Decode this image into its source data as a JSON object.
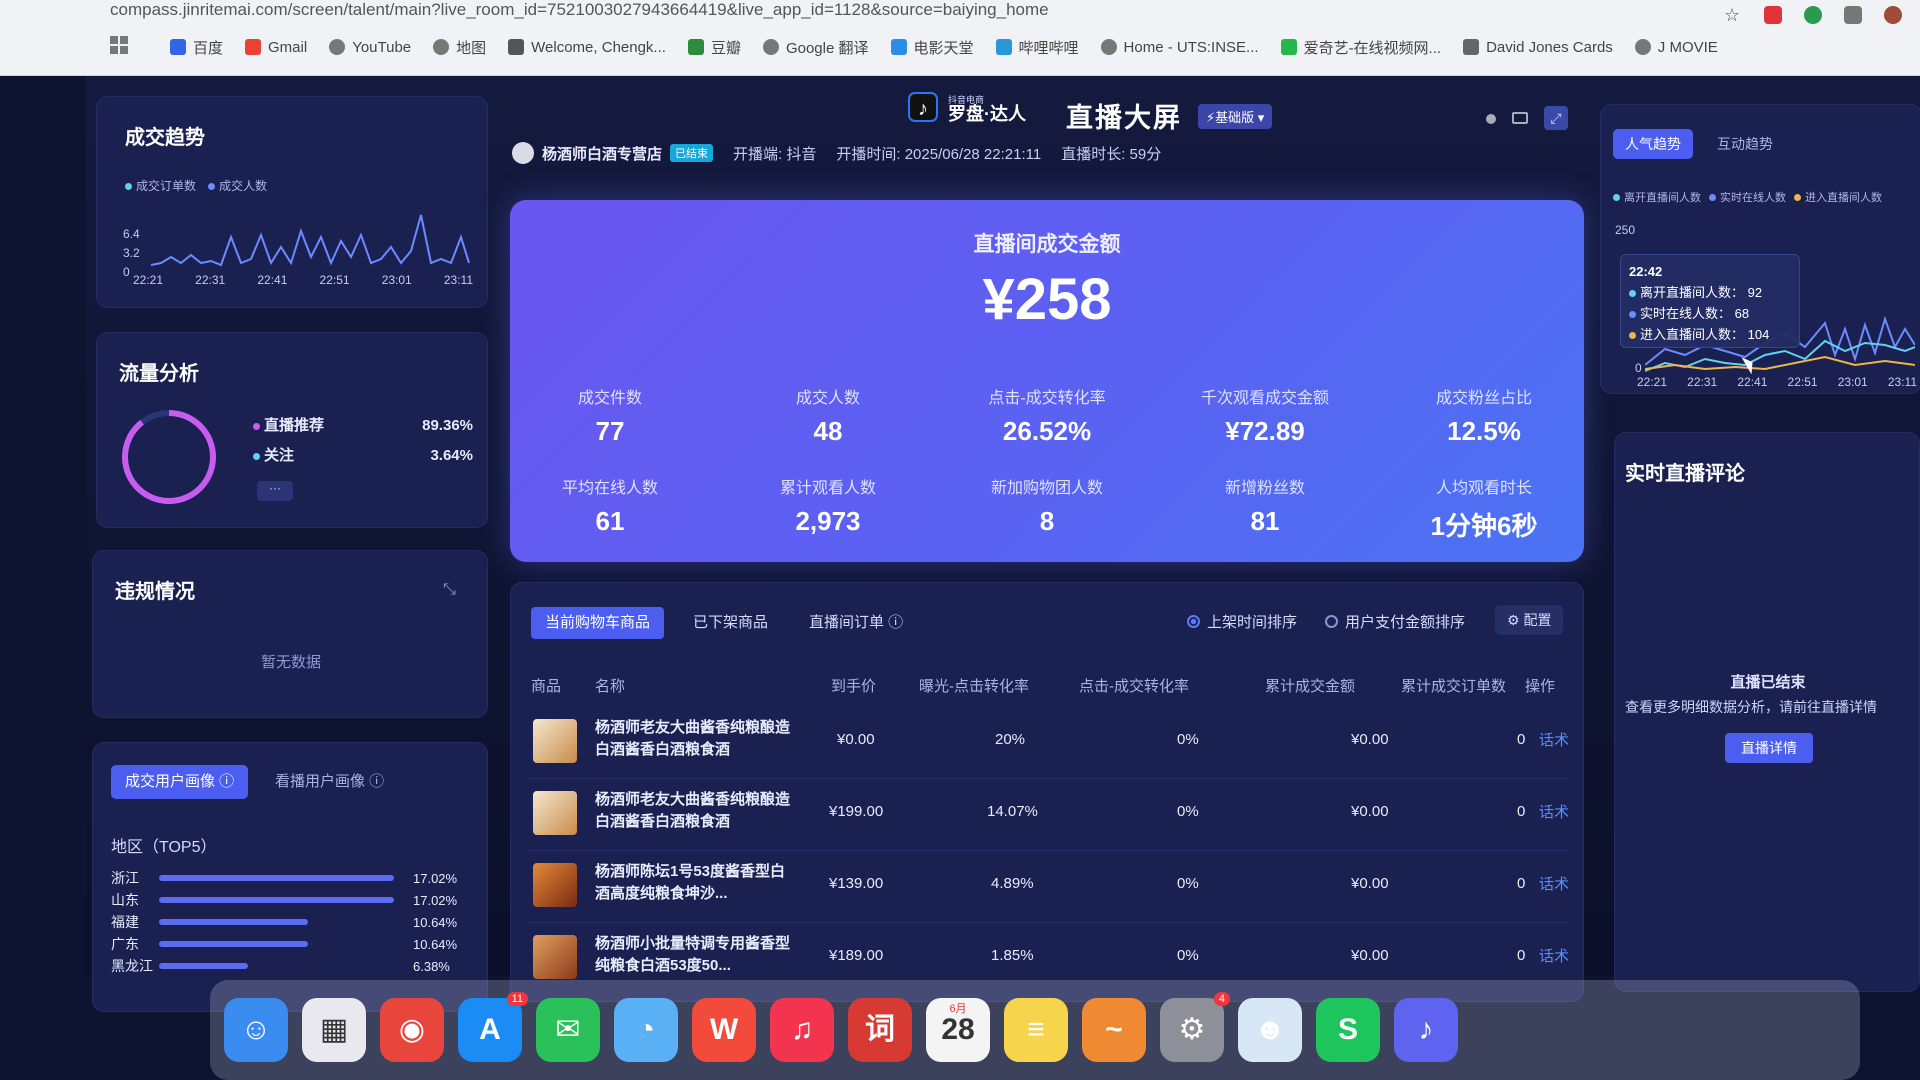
{
  "browser": {
    "url": "compass.jinritemai.com/screen/talent/main?live_room_id=7521003027943664419&live_app_id=1128&source=baiying_home",
    "bookmarks": [
      "百度",
      "Gmail",
      "YouTube",
      "地图",
      "Welcome, Chengk...",
      "豆瓣",
      "Google 翻译",
      "电影天堂",
      "哔哩哔哩",
      "Home - UTS:INSE...",
      "爱奇艺-在线视频网...",
      "David Jones Cards",
      "J MOVIE"
    ]
  },
  "header": {
    "brand_top": "抖音电商",
    "brand": "罗盘·达人",
    "title": "直播大屏",
    "edition": "⚡基础版 ▾",
    "shop": "杨酒师白酒专营店",
    "status": "已结束",
    "platform_label": "开播端: 抖音",
    "start_time": "开播时间: 2025/06/28 22:21:11",
    "duration": "直播时长: 59分"
  },
  "trend": {
    "title": "成交趋势",
    "legend": [
      "成交订单数",
      "成交人数"
    ],
    "y_ticks": [
      "6.4",
      "3.2",
      "0"
    ],
    "x_ticks": [
      "22:21",
      "22:31",
      "22:41",
      "22:51",
      "23:01",
      "23:11"
    ]
  },
  "traffic": {
    "title": "流量分析",
    "items": [
      {
        "label": "直播推荐",
        "value": "89.36%"
      },
      {
        "label": "关注",
        "value": "3.64%"
      }
    ],
    "more": "···"
  },
  "violation": {
    "title": "违规情况",
    "empty": "暂无数据"
  },
  "portrait": {
    "tabs": [
      "成交用户画像",
      "看播用户画像"
    ],
    "region_title": "地区（TOP5）",
    "regions": [
      {
        "name": "浙江",
        "value": "17.02%",
        "frac": 0.98
      },
      {
        "name": "山东",
        "value": "17.02%",
        "frac": 0.98
      },
      {
        "name": "福建",
        "value": "10.64%",
        "frac": 0.62
      },
      {
        "name": "广东",
        "value": "10.64%",
        "frac": 0.62
      },
      {
        "name": "黑龙江",
        "value": "6.38%",
        "frac": 0.37
      }
    ]
  },
  "hero": {
    "label": "直播间成交金额",
    "value": "¥258",
    "metrics": [
      {
        "label": "成交件数",
        "value": "77"
      },
      {
        "label": "成交人数",
        "value": "48"
      },
      {
        "label": "点击-成交转化率",
        "value": "26.52%"
      },
      {
        "label": "千次观看成交金额",
        "value": "¥72.89"
      },
      {
        "label": "成交粉丝占比",
        "value": "12.5%"
      },
      {
        "label": "平均在线人数",
        "value": "61"
      },
      {
        "label": "累计观看人数",
        "value": "2,973"
      },
      {
        "label": "新加购物团人数",
        "value": "8"
      },
      {
        "label": "新增粉丝数",
        "value": "81"
      },
      {
        "label": "人均观看时长",
        "value": "1分钟6秒"
      }
    ]
  },
  "table": {
    "tabs": [
      "当前购物车商品",
      "已下架商品",
      "直播间订单 ⓘ"
    ],
    "sort": [
      "上架时间排序",
      "用户支付金额排序"
    ],
    "config": "⚙ 配置",
    "headers": [
      "商品",
      "名称",
      "到手价",
      "曝光-点击转化率",
      "点击-成交转化率",
      "累计成交金额",
      "累计成交订单数",
      "操作"
    ],
    "rows": [
      {
        "name": "杨酒师老友大曲酱香纯粮酿造白酒酱香白酒粮食酒",
        "price": "¥0.00",
        "ctr": "20%",
        "cvr": "0%",
        "gmv": "¥0.00",
        "orders": "0",
        "action": "话术"
      },
      {
        "name": "杨酒师老友大曲酱香纯粮酿造白酒酱香白酒粮食酒",
        "price": "¥199.00",
        "ctr": "14.07%",
        "cvr": "0%",
        "gmv": "¥0.00",
        "orders": "0",
        "action": "话术"
      },
      {
        "name": "杨酒师陈坛1号53度酱香型白酒高度纯粮食坤沙...",
        "price": "¥139.00",
        "ctr": "4.89%",
        "cvr": "0%",
        "gmv": "¥0.00",
        "orders": "0",
        "action": "话术"
      },
      {
        "name": "杨酒师小批量特调专用酱香型纯粮食白酒53度50...",
        "price": "¥189.00",
        "ctr": "1.85%",
        "cvr": "0%",
        "gmv": "¥0.00",
        "orders": "0",
        "action": "话术"
      }
    ]
  },
  "popularity": {
    "tabs": [
      "人气趋势",
      "互动趋势"
    ],
    "legend": [
      "离开直播间人数",
      "实时在线人数",
      "进入直播间人数"
    ],
    "y_ticks": [
      "250",
      "0"
    ],
    "x_ticks": [
      "22:21",
      "22:31",
      "22:41",
      "22:51",
      "23:01",
      "23:11"
    ],
    "tooltip": {
      "time": "22:42",
      "rows": [
        {
          "label": "离开直播间人数：",
          "value": "92"
        },
        {
          "label": "实时在线人数：",
          "value": "68"
        },
        {
          "label": "进入直播间人数：",
          "value": "104"
        }
      ]
    }
  },
  "comments": {
    "title": "实时直播评论",
    "ended": "直播已结束",
    "hint": "查看更多明细数据分析，请前往直播详情",
    "button": "直播详情"
  },
  "dock": {
    "apps": [
      {
        "name": "finder",
        "glyph": "☺",
        "color": "#3b8cf0"
      },
      {
        "name": "launchpad",
        "glyph": "▦",
        "color": "#e8e8ee"
      },
      {
        "name": "chrome",
        "glyph": "◉",
        "color": "#e8453c"
      },
      {
        "name": "app-store",
        "glyph": "A",
        "color": "#1c8cf5",
        "badge": "11"
      },
      {
        "name": "wechat",
        "glyph": "✉",
        "color": "#2bc15a"
      },
      {
        "name": "messages",
        "glyph": "◔",
        "color": "#5ab0f5"
      },
      {
        "name": "wps",
        "glyph": "W",
        "color": "#f24b3c"
      },
      {
        "name": "music",
        "glyph": "♫",
        "color": "#f3344f"
      },
      {
        "name": "dictionary",
        "glyph": "词",
        "color": "#d63a33"
      },
      {
        "name": "calendar",
        "glyph": "28",
        "color": "#f4f4f4"
      },
      {
        "name": "notes",
        "glyph": "≡",
        "color": "#f6d44c"
      },
      {
        "name": "freeform",
        "glyph": "~",
        "color": "#f08a32"
      },
      {
        "name": "system-settings",
        "glyph": "⚙",
        "color": "#8d9099",
        "badge": "4"
      },
      {
        "name": "avatar-app",
        "glyph": "☻",
        "color": "#d8e7f6"
      },
      {
        "name": "spotify-like",
        "glyph": "S",
        "color": "#1ec55d"
      },
      {
        "name": "tiktok-app",
        "glyph": "♪",
        "color": "#5e63f0"
      }
    ],
    "calendar_month": "6月"
  }
}
